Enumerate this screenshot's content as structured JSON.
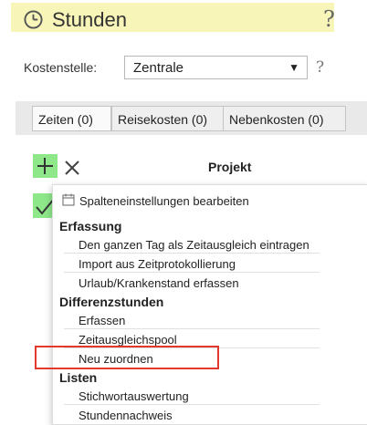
{
  "header": {
    "title": "Stunden",
    "help": "?"
  },
  "kostenstelle": {
    "label": "Kostenstelle:",
    "value": "Zentrale",
    "help": "?"
  },
  "tabs": [
    {
      "label": "Zeiten (0)"
    },
    {
      "label": "Reisekosten (0)"
    },
    {
      "label": "Nebenkosten (0)"
    }
  ],
  "table": {
    "column": "Projekt"
  },
  "menu": {
    "first_item": "Spalteneinstellungen bearbeiten",
    "sections": [
      {
        "title": "Erfassung",
        "items": [
          "Den ganzen Tag als Zeitausgleich eintragen",
          "Import aus Zeitprotokollierung",
          "Urlaub/Krankenstand erfassen"
        ]
      },
      {
        "title": "Differenzstunden",
        "items": [
          "Erfassen",
          "Zeitausgleichspool",
          "Neu zuordnen"
        ]
      },
      {
        "title": "Listen",
        "items": [
          "Stichwortauswertung",
          "Stundennachweis"
        ]
      }
    ]
  },
  "icons": [
    "clock-icon",
    "help-icon",
    "plus-icon",
    "close-icon",
    "checkmark-icon",
    "calendar-icon"
  ],
  "colors": {
    "header_bg": "#f7f5b8",
    "action_green": "#8ee88a",
    "highlight_red": "#e2392c"
  }
}
